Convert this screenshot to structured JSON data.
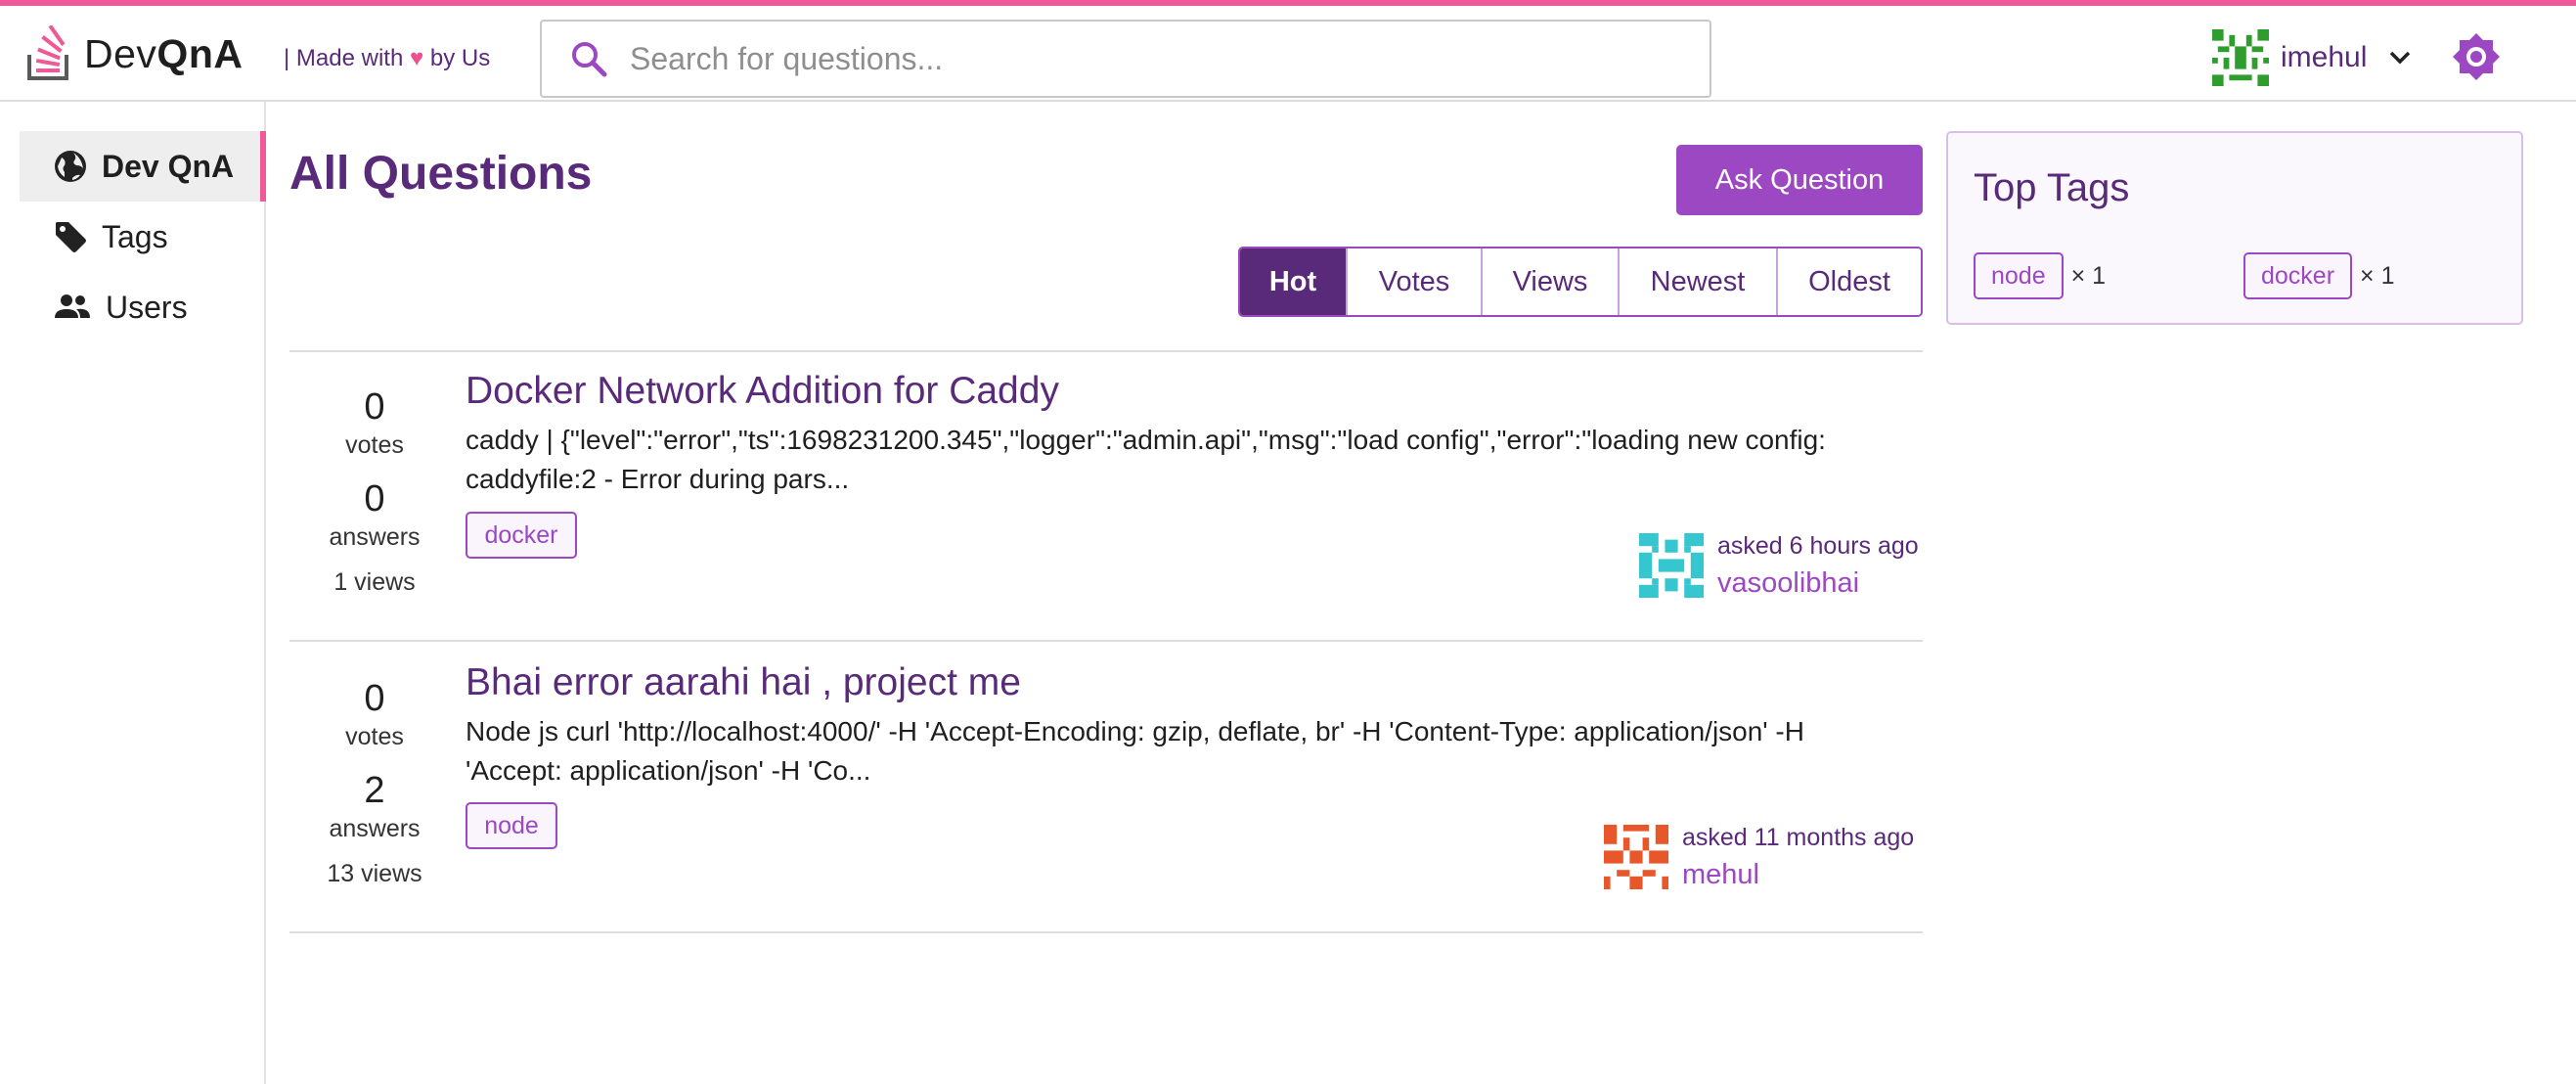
{
  "header": {
    "brand_prefix": "Dev",
    "brand_suffix": "QnA",
    "tagline_before": "| Made with",
    "tagline_heart": "♥",
    "tagline_after": "by Us",
    "search_placeholder": "Search for questions...",
    "username": "imehul",
    "icons": [
      "stack-logo-icon",
      "search-icon",
      "chevron-down-icon",
      "theme-toggle-icon"
    ]
  },
  "sidebar": {
    "items": [
      {
        "label": "Dev QnA",
        "icon": "globe-icon",
        "active": true
      },
      {
        "label": "Tags",
        "icon": "tag-icon",
        "active": false
      },
      {
        "label": "Users",
        "icon": "users-icon",
        "active": false
      }
    ]
  },
  "main": {
    "title": "All Questions",
    "ask_button": "Ask Question",
    "filters": [
      "Hot",
      "Votes",
      "Views",
      "Newest",
      "Oldest"
    ],
    "active_filter": "Hot",
    "questions": [
      {
        "votes": "0",
        "votes_label": "votes",
        "answers": "0",
        "answers_label": "answers",
        "views": "1 views",
        "title": "Docker Network Addition for Caddy",
        "excerpt": "caddy | {\"level\":\"error\",\"ts\":1698231200.345\",\"logger\":\"admin.api\",\"msg\":\"load config\",\"error\":\"loading new config: caddyfile:2 - Error during pars...",
        "tags": [
          "docker"
        ],
        "asked": "asked 6 hours ago",
        "author": "vasoolibhai"
      },
      {
        "votes": "0",
        "votes_label": "votes",
        "answers": "2",
        "answers_label": "answers",
        "views": "13 views",
        "title": "Bhai error aarahi hai , project me",
        "excerpt": "Node js curl 'http://localhost:4000/' -H 'Accept-Encoding: gzip, deflate, br' -H 'Content-Type: application/json' -H 'Accept: application/json' -H 'Co...",
        "tags": [
          "node"
        ],
        "asked": "asked 11 months ago",
        "author": "mehul"
      }
    ]
  },
  "top_tags": {
    "title": "Top Tags",
    "items": [
      {
        "name": "node",
        "count": "× 1"
      },
      {
        "name": "docker",
        "count": "× 1"
      }
    ]
  },
  "colors": {
    "accent_pink": "#ee5a98",
    "primary_purple": "#9b48c2",
    "dark_purple": "#5a2a7a"
  }
}
